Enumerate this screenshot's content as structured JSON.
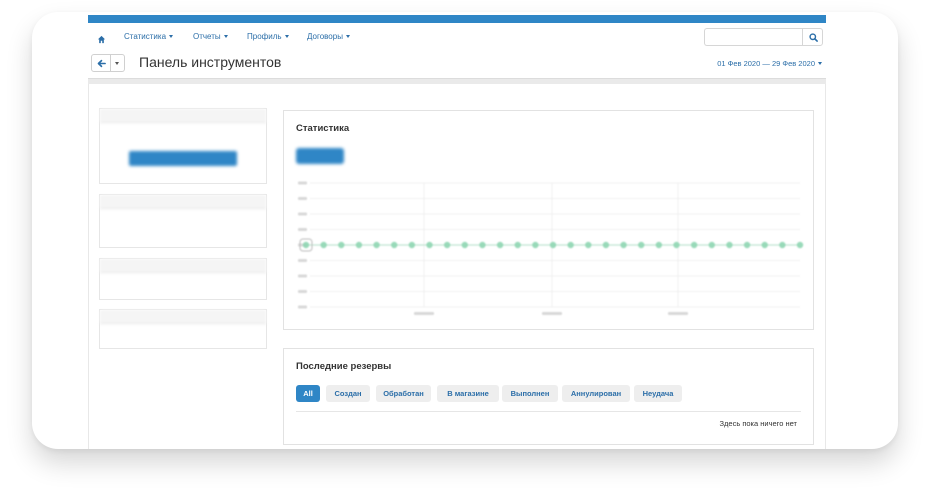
{
  "nav": {
    "items": [
      {
        "label": "Статистика"
      },
      {
        "label": "Отчеты"
      },
      {
        "label": "Профиль"
      },
      {
        "label": "Договоры"
      }
    ],
    "search_placeholder": ""
  },
  "header": {
    "title": "Панель инструментов",
    "date_range": "01 Фев 2020 — 29 Фев 2020"
  },
  "statistics": {
    "title": "Статистика"
  },
  "chart_data": {
    "type": "line",
    "title": "Статистика",
    "x": [
      1,
      2,
      3,
      4,
      5,
      6,
      7,
      8,
      9,
      10,
      11,
      12,
      13,
      14,
      15,
      16,
      17,
      18,
      19,
      20,
      21,
      22,
      23,
      24,
      25,
      26,
      27,
      28,
      29
    ],
    "series": [
      {
        "values": [
          0,
          0,
          0,
          0,
          0,
          0,
          0,
          0,
          0,
          0,
          0,
          0,
          0,
          0,
          0,
          0,
          0,
          0,
          0,
          0,
          0,
          0,
          0,
          0,
          0,
          0,
          0,
          0,
          0
        ]
      }
    ],
    "ylim": [
      -1,
      1
    ],
    "grid": true
  },
  "reserves": {
    "title": "Последние резервы",
    "tabs": [
      "All",
      "Создан",
      "Обработан",
      "В магазине",
      "Выполнен",
      "Аннулирован",
      "Неудача"
    ],
    "active_tab": 0,
    "empty_text": "Здесь пока ничего нет"
  },
  "colors": {
    "accent": "#2f86c6",
    "link": "#2b6ea8",
    "series": "#8fd6b2"
  },
  "icons": {
    "home": "home-icon",
    "search": "search-icon",
    "back": "arrow-left-icon"
  }
}
